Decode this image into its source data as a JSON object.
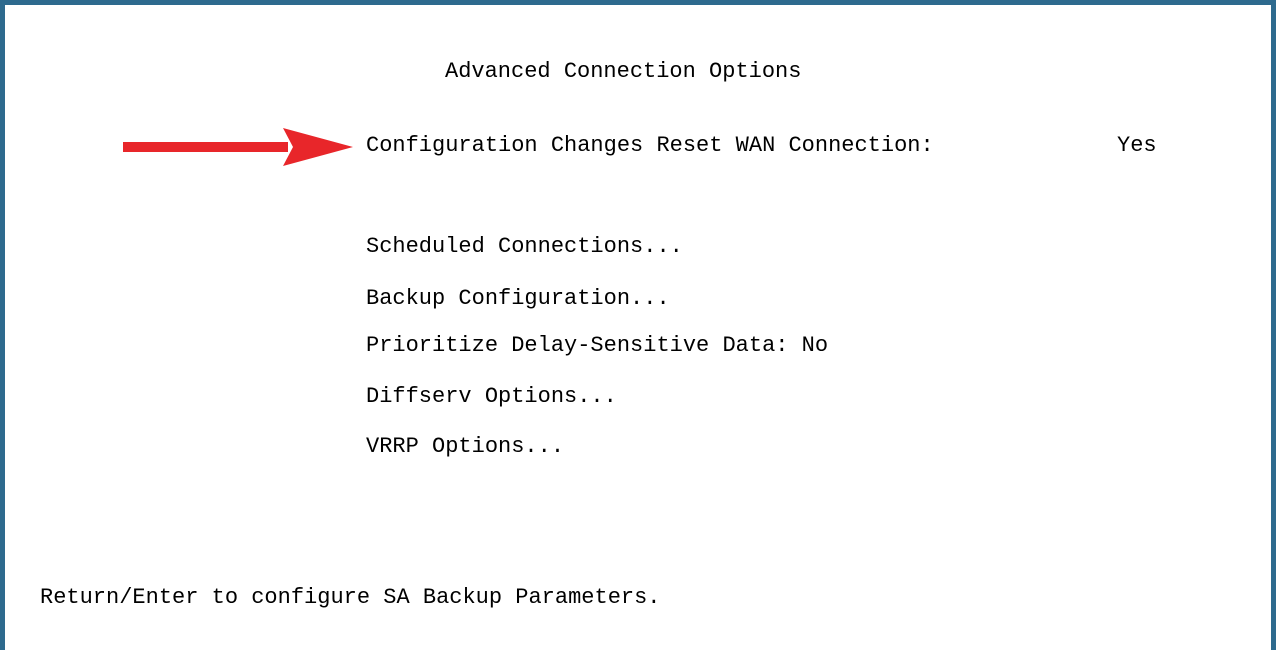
{
  "screen": {
    "title": "Advanced Connection Options",
    "reset_wan": {
      "label": "Configuration Changes Reset WAN Connection:",
      "value": "Yes"
    },
    "menu_items": [
      "Scheduled Connections...",
      "Backup Configuration...",
      "Prioritize Delay-Sensitive Data: No",
      "Diffserv Options...",
      "VRRP Options..."
    ],
    "status_line": "Return/Enter to configure SA Backup Parameters."
  },
  "colors": {
    "frame": "#2e6a8e",
    "arrow": "#e8262a",
    "text": "#000000",
    "background": "#ffffff"
  },
  "icons": {
    "pointer": "red-arrow-icon"
  }
}
